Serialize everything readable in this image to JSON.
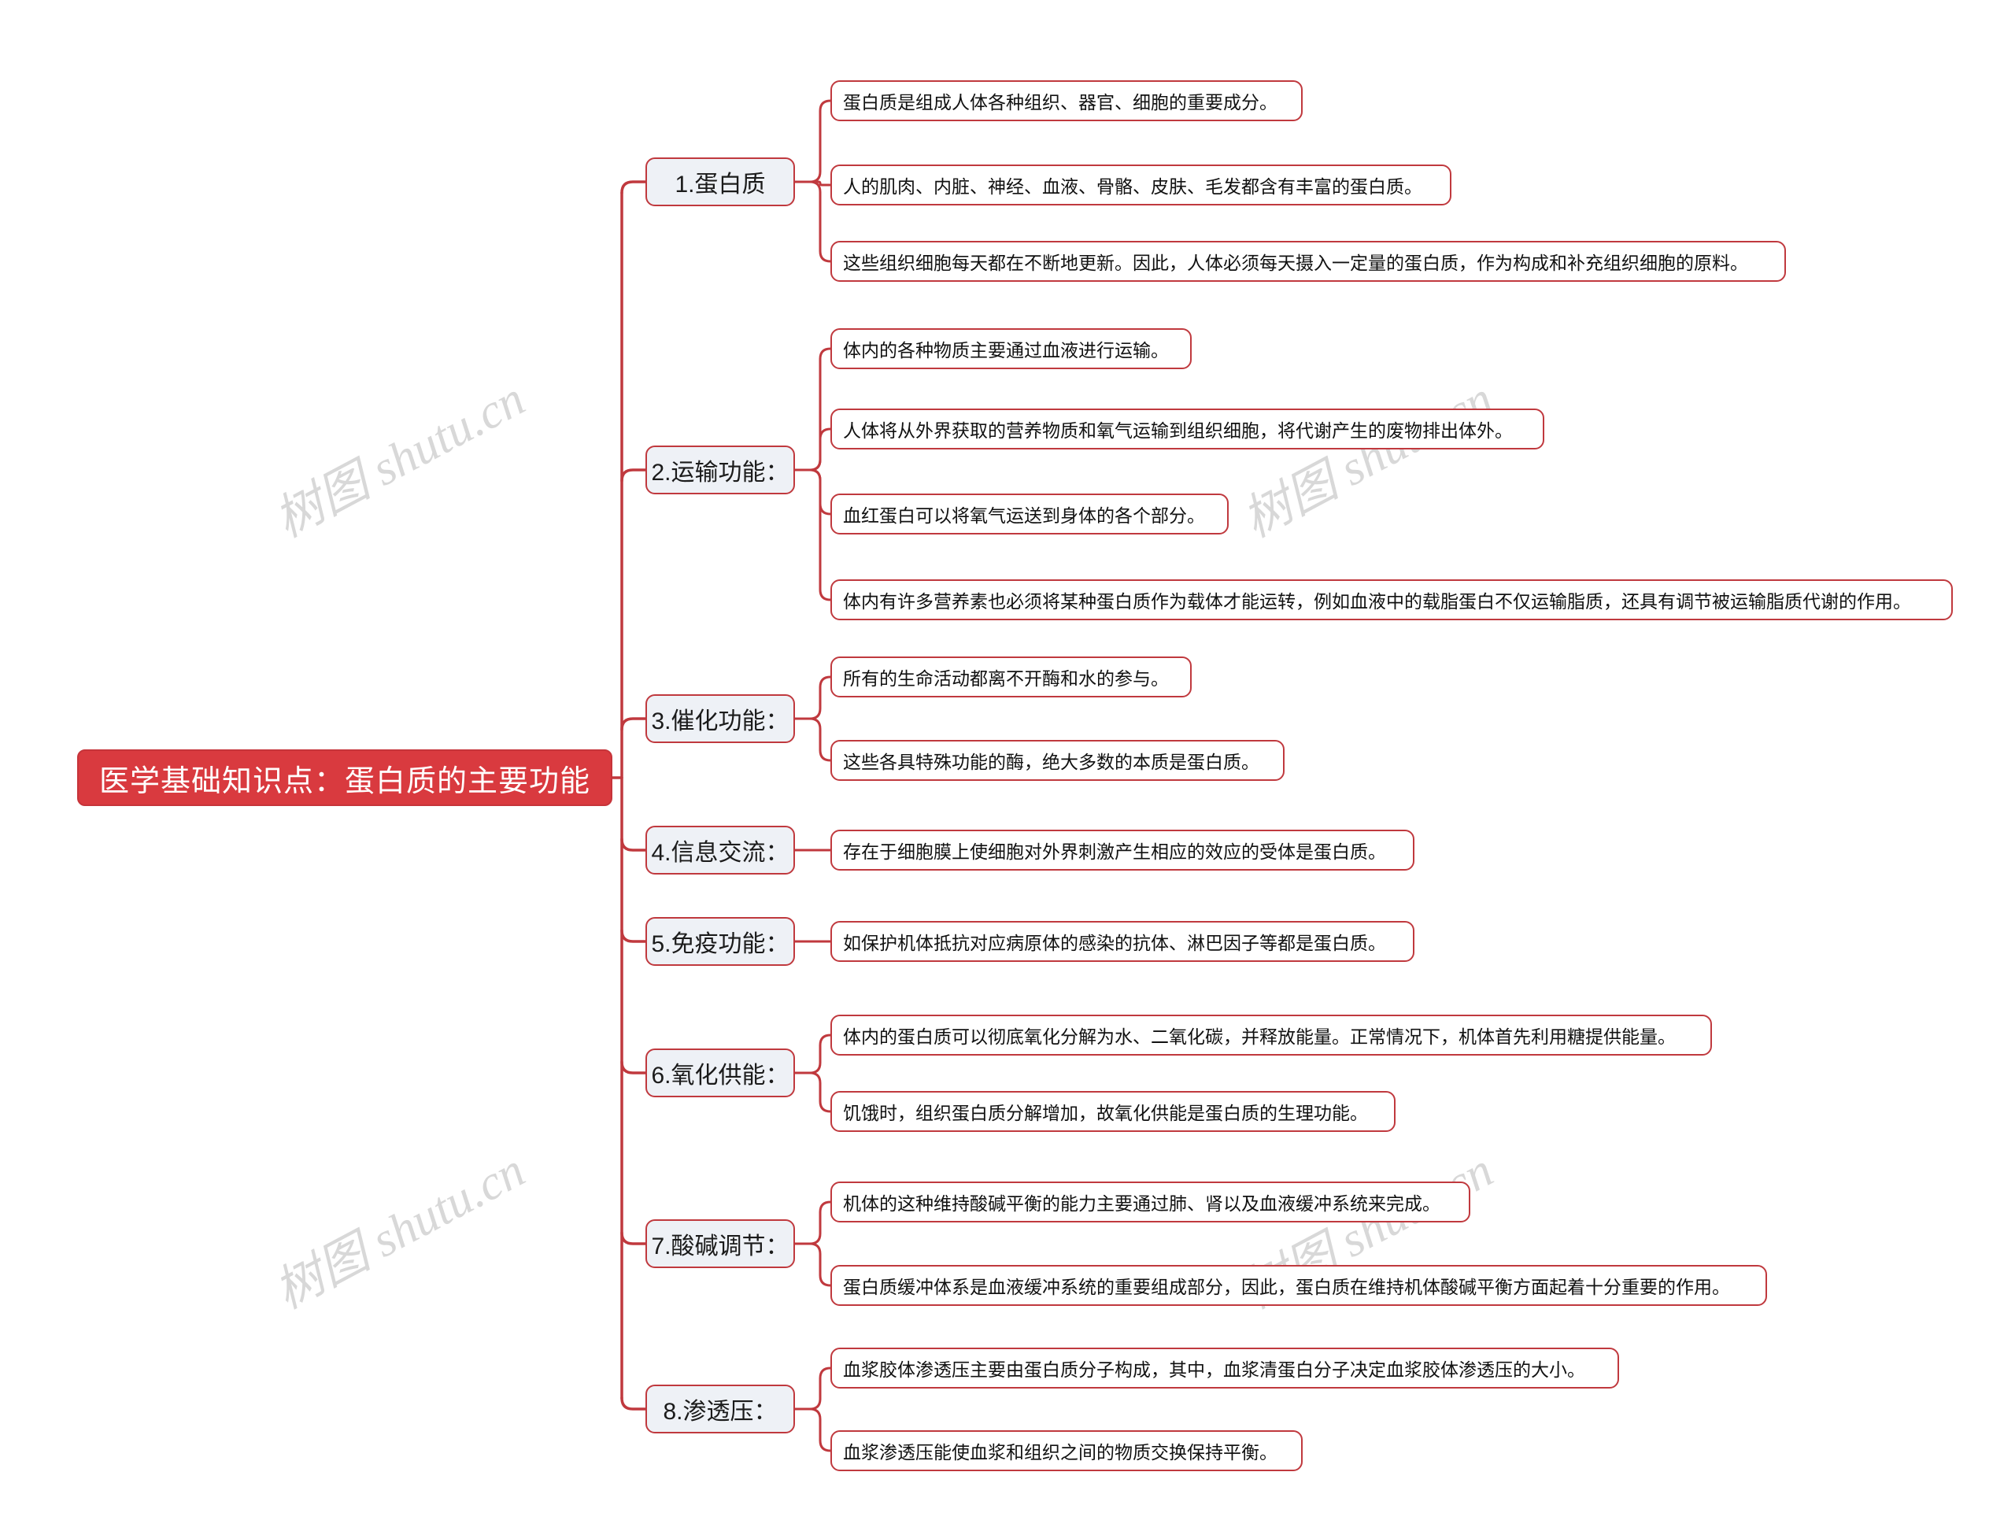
{
  "document": {
    "type": "mindmap",
    "title": "医学基础知识点：蛋白质的主要功能",
    "background_color": "#ffffff",
    "accent_color": "#c0393e",
    "root_fill_color": "#d93a3f",
    "branch_fill_color": "#eef1f6",
    "leaf_fill_color": "#ffffff"
  },
  "watermark": {
    "text": "树图 shutu.cn",
    "color": "#d8d8d8"
  },
  "root": {
    "label": "医学基础知识点：蛋白质的主要功能"
  },
  "branches": [
    {
      "label": "1.蛋白质",
      "leaves": [
        "蛋白质是组成人体各种组织、器官、细胞的重要成分。",
        "人的肌肉、内脏、神经、血液、骨骼、皮肤、毛发都含有丰富的蛋白质。",
        "这些组织细胞每天都在不断地更新。因此，人体必须每天摄入一定量的蛋白质，作为构成和补充组织细胞的原料。"
      ]
    },
    {
      "label": "2.运输功能：",
      "leaves": [
        "体内的各种物质主要通过血液进行运输。",
        "人体将从外界获取的营养物质和氧气运输到组织细胞，将代谢产生的废物排出体外。",
        "血红蛋白可以将氧气运送到身体的各个部分。",
        "体内有许多营养素也必须将某种蛋白质作为载体才能运转，例如血液中的载脂蛋白不仅运输脂质，还具有调节被运输脂质代谢的作用。"
      ]
    },
    {
      "label": "3.催化功能：",
      "leaves": [
        "所有的生命活动都离不开酶和水的参与。",
        "这些各具特殊功能的酶，绝大多数的本质是蛋白质。"
      ]
    },
    {
      "label": "4.信息交流：",
      "leaves": [
        "存在于细胞膜上使细胞对外界刺激产生相应的效应的受体是蛋白质。"
      ]
    },
    {
      "label": "5.免疫功能：",
      "leaves": [
        "如保护机体抵抗对应病原体的感染的抗体、淋巴因子等都是蛋白质。"
      ]
    },
    {
      "label": "6.氧化供能：",
      "leaves": [
        "体内的蛋白质可以彻底氧化分解为水、二氧化碳，并释放能量。正常情况下，机体首先利用糖提供能量。",
        "饥饿时，组织蛋白质分解增加，故氧化供能是蛋白质的生理功能。"
      ]
    },
    {
      "label": "7.酸碱调节：",
      "leaves": [
        "机体的这种维持酸碱平衡的能力主要通过肺、肾以及血液缓冲系统来完成。",
        "蛋白质缓冲体系是血液缓冲系统的重要组成部分，因此，蛋白质在维持机体酸碱平衡方面起着十分重要的作用。"
      ]
    },
    {
      "label": "8.渗透压：",
      "leaves": [
        "血浆胶体渗透压主要由蛋白质分子构成，其中，血浆清蛋白分子决定血浆胶体渗透压的大小。",
        "血浆渗透压能使血浆和组织之间的物质交换保持平衡。"
      ]
    }
  ]
}
